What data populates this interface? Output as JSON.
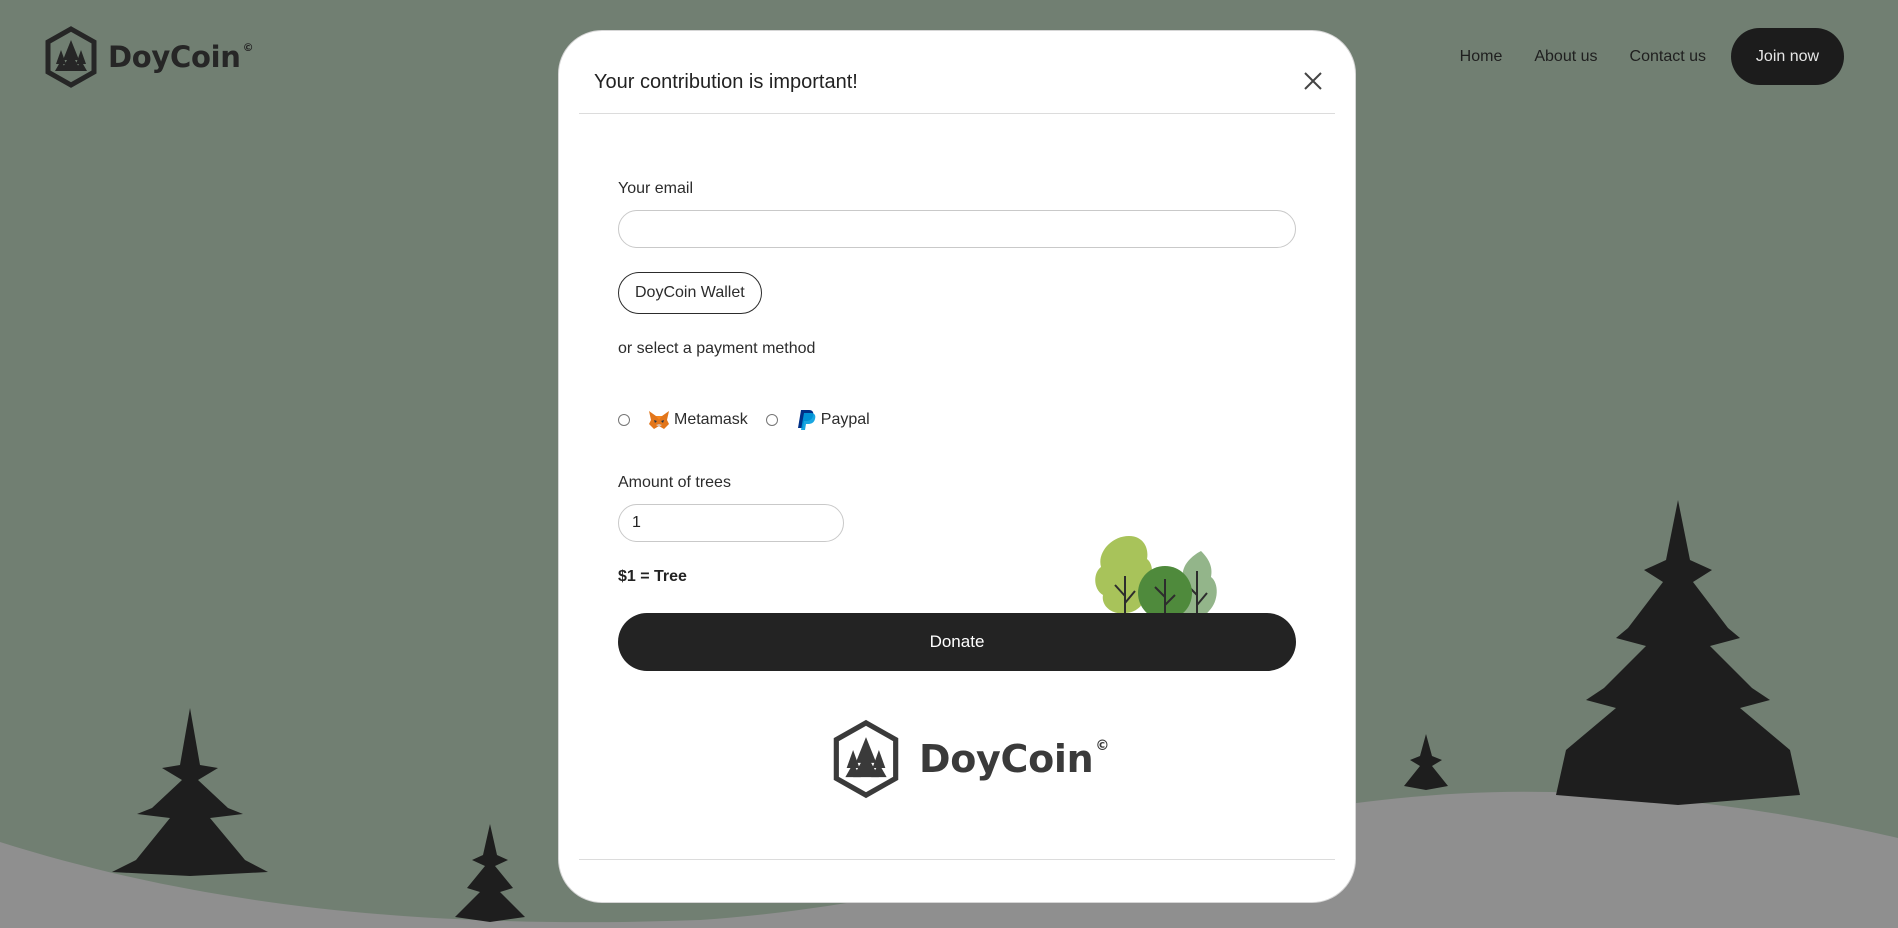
{
  "brand": {
    "name": "DoyCoin",
    "mark": "©"
  },
  "nav": {
    "links": [
      "Home",
      "About us",
      "Contact us"
    ],
    "cta_label": "Join now"
  },
  "modal": {
    "title": "Your contribution is important!",
    "email_label": "Your email",
    "email_value": "",
    "wallet_button_label": "DoyCoin Wallet",
    "payment_prompt": "or select a payment method",
    "payment_methods": [
      {
        "label": "Metamask",
        "icon": "metamask-fox-icon",
        "selected": false
      },
      {
        "label": "Paypal",
        "icon": "paypal-icon",
        "selected": false
      }
    ],
    "trees_label": "Amount of trees",
    "trees_value": "1",
    "rate_text": "$1 = Tree",
    "donate_label": "Donate"
  },
  "colors": {
    "background": "#717f72",
    "ground": "#8f8f8f",
    "tree_silhouette": "#1e1e1e",
    "button_dark": "#232323",
    "tree_light_green": "#a8c35a",
    "tree_dark_green": "#4f8a3c",
    "tree_sage": "#93b58a"
  }
}
